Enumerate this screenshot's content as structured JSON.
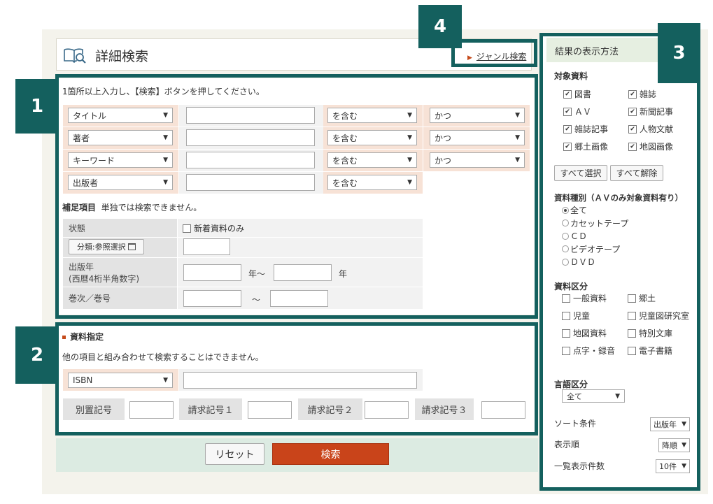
{
  "header": {
    "title": "詳細検索",
    "genre_link": "ジャンル検索"
  },
  "callouts": [
    "1",
    "2",
    "3",
    "4"
  ],
  "search": {
    "instruction": "1箇所以上入力し、【検索】ボタンを押してください。",
    "rows": [
      {
        "field": "タイトル",
        "match": "を含む",
        "logic": "かつ"
      },
      {
        "field": "著者",
        "match": "を含む",
        "logic": "かつ"
      },
      {
        "field": "キーワード",
        "match": "を含む",
        "logic": "かつ"
      },
      {
        "field": "出版者",
        "match": "を含む"
      }
    ],
    "supplement_title": "補足項目",
    "supplement_note": "単独では検索できません。",
    "status_label": "状態",
    "new_only": "新着資料のみ",
    "classification_button": "分類:参照選択",
    "pub_year_label": "出版年",
    "pub_year_sub": "(西暦4桁半角数字)",
    "year_from_suffix": "年～",
    "year_to_suffix": "年",
    "volume_label": "巻次／巻号",
    "tilde": "～"
  },
  "material": {
    "title": "資料指定",
    "note": "他の項目と組み合わせて検索することはできません。",
    "isbn_select": "ISBN",
    "labels": [
      "別置記号",
      "請求記号１",
      "請求記号２",
      "請求記号３"
    ]
  },
  "actions": {
    "reset": "リセット",
    "search": "検索"
  },
  "right_panel": {
    "title": "結果の表示方法",
    "target_title": "対象資料",
    "targets": [
      {
        "label": "図書",
        "checked": true
      },
      {
        "label": "雑誌",
        "checked": true
      },
      {
        "label": "ＡＶ",
        "checked": true
      },
      {
        "label": "新聞記事",
        "checked": true
      },
      {
        "label": "雑誌記事",
        "checked": true
      },
      {
        "label": "人物文献",
        "checked": true
      },
      {
        "label": "郷土画像",
        "checked": true
      },
      {
        "label": "地図画像",
        "checked": true
      }
    ],
    "select_all": "すべて選択",
    "clear_all": "すべて解除",
    "media_title": "資料種別（ＡＶのみ対象資料有り）",
    "media_options": [
      {
        "label": "全て",
        "selected": true
      },
      {
        "label": "カセットテープ",
        "selected": false
      },
      {
        "label": "ＣＤ",
        "selected": false
      },
      {
        "label": "ビデオテープ",
        "selected": false
      },
      {
        "label": "ＤＶＤ",
        "selected": false
      }
    ],
    "category_title": "資料区分",
    "categories": [
      "一般資料",
      "郷土",
      "児童",
      "児童図研究室",
      "地図資料",
      "特別文庫",
      "点字・録音",
      "電子書籍"
    ],
    "language_title": "言語区分",
    "language_value": "全て",
    "sort_label": "ソート条件",
    "sort_value": "出版年",
    "order_label": "表示順",
    "order_value": "降順",
    "count_label": "一覧表示件数",
    "count_value": "10件"
  },
  "colors": {
    "frame": "#14605e",
    "search_button": "#c9441a",
    "peach": "#f7e2d6",
    "panel_header": "#e6efe1"
  }
}
